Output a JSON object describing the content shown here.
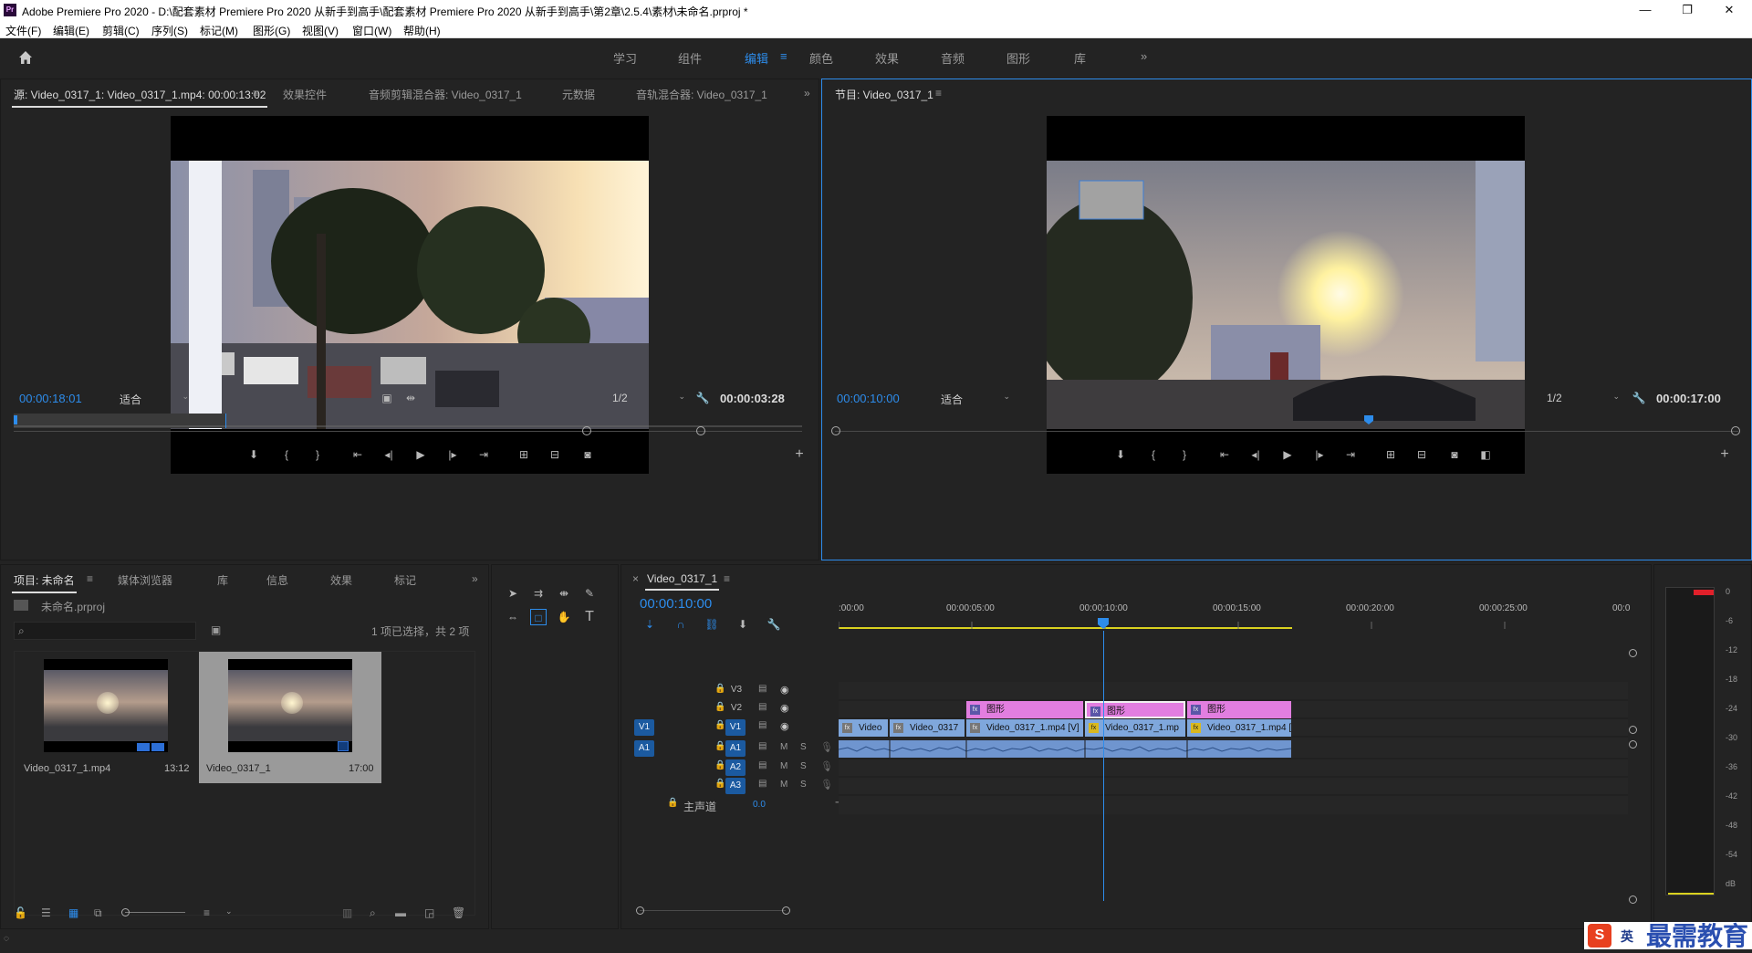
{
  "window": {
    "app_icon": "Pr",
    "title": "Adobe Premiere Pro 2020 - D:\\配套素材 Premiere Pro 2020 从新手到高手\\配套素材 Premiere Pro 2020 从新手到高手\\第2章\\2.5.4\\素材\\未命名.prproj *",
    "minimize": "—",
    "maximize": "❐",
    "close": "✕"
  },
  "menu": [
    "文件(F)",
    "编辑(E)",
    "剪辑(C)",
    "序列(S)",
    "标记(M)",
    "图形(G)",
    "视图(V)",
    "窗口(W)",
    "帮助(H)"
  ],
  "workspaces": {
    "items": [
      "学习",
      "组件",
      "编辑",
      "颜色",
      "效果",
      "音频",
      "图形",
      "库"
    ],
    "active": "编辑",
    "active_menu": "≡",
    "more": "»"
  },
  "source_panel": {
    "tabs": [
      "源: Video_0317_1: Video_0317_1.mp4: 00:00:13:02",
      "效果控件",
      "音频剪辑混合器: Video_0317_1",
      "元数据",
      "音轨混合器: Video_0317_1"
    ],
    "tab_menu": "≡",
    "more": "»",
    "timecode_in": "00:00:18:01",
    "fit": "适合",
    "resolution": "1/2",
    "timecode_dur": "00:00:03:28",
    "add": "+"
  },
  "program_panel": {
    "tab": "节目: Video_0317_1",
    "tab_menu": "≡",
    "timecode_in": "00:00:10:00",
    "fit": "适合",
    "resolution": "1/2",
    "timecode_dur": "00:00:17:00",
    "add": "+"
  },
  "project_panel": {
    "tabs": [
      "项目: 未命名",
      "媒体浏览器",
      "库",
      "信息",
      "效果",
      "标记"
    ],
    "tab_menu": "≡",
    "more": "»",
    "project_file": "未命名.prproj",
    "search_placeholder": "",
    "selection_info": "1 项已选择，共 2 项",
    "items": [
      {
        "name": "Video_0317_1.mp4",
        "duration": "13:12"
      },
      {
        "name": "Video_0317_1",
        "duration": "17:00"
      }
    ]
  },
  "timeline": {
    "tab": "Video_0317_1",
    "tab_close": "×",
    "tab_menu": "≡",
    "timecode": "00:00:10:00",
    "ruler_labels": [
      ":00:00",
      "00:00:05:00",
      "00:00:10:00",
      "00:00:15:00",
      "00:00:20:00",
      "00:00:25:00",
      "00:0"
    ],
    "tracks_video": [
      {
        "target": "",
        "name": "V3"
      },
      {
        "target": "",
        "name": "V2"
      },
      {
        "target": "V1",
        "name": "V1"
      }
    ],
    "tracks_audio": [
      {
        "target": "A1",
        "name": "A1",
        "m": "M",
        "s": "S"
      },
      {
        "target": "",
        "name": "A2",
        "m": "M",
        "s": "S"
      },
      {
        "target": "",
        "name": "A3",
        "m": "M",
        "s": "S"
      }
    ],
    "master": {
      "label": "主声道",
      "value": "0.0"
    },
    "v2_clips": [
      "图形",
      "图形",
      "图形"
    ],
    "v1_clips": [
      "Video",
      "Video_0317",
      "Video_0317_1.mp4 [V]",
      "Video_0317_1.mp",
      "Video_0317_1.mp4 ["
    ]
  },
  "meter": {
    "labels": [
      "0",
      "-6",
      "-12",
      "-18",
      "-24",
      "-30",
      "-36",
      "-42",
      "-48",
      "-54",
      "dB"
    ]
  },
  "watermark": {
    "text": "最需教育",
    "ime": "英",
    "ime_logo": "S"
  },
  "colors": {
    "accent": "#2d8ceb",
    "graphic_clip": "#e27ee0",
    "video_clip": "#7fa7dc",
    "audio_clip": "#6f95cf",
    "work_area": "#d9d11f"
  }
}
